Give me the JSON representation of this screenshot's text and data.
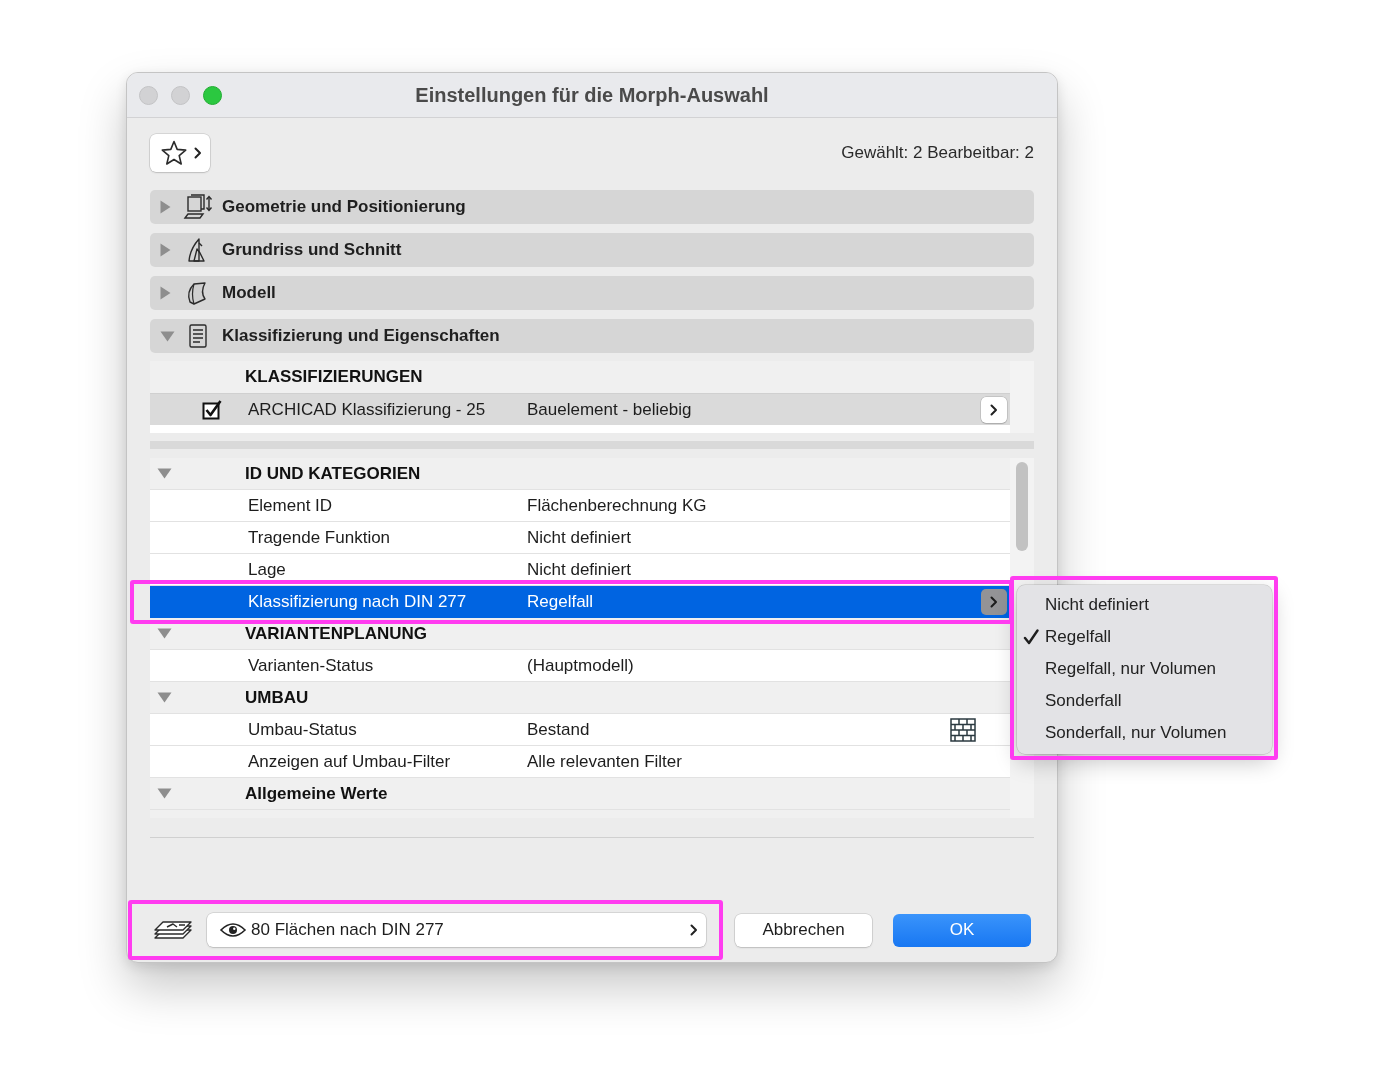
{
  "window": {
    "title": "Einstellungen für die Morph-Auswahl"
  },
  "toolbar": {
    "selection_info": "Gewählt: 2 Bearbeitbar: 2"
  },
  "sections": [
    {
      "kind": "geometry",
      "label": "Geometrie und Positionierung",
      "expanded": false
    },
    {
      "kind": "floorplan",
      "label": "Grundriss und Schnitt",
      "expanded": false
    },
    {
      "kind": "model",
      "label": "Modell",
      "expanded": false
    },
    {
      "kind": "classification",
      "label": "Klassifizierung und Eigenschaften",
      "expanded": true
    }
  ],
  "classifications": {
    "heading": "KLASSIFIZIERUNGEN",
    "rows": [
      {
        "checked": true,
        "system": "ARCHICAD Klassifizierung - 25",
        "value": "Bauelement - beliebig",
        "selected": true
      }
    ]
  },
  "properties": {
    "groups": [
      {
        "label": "ID UND KATEGORIEN",
        "expanded": true,
        "rows": [
          {
            "kind": "text",
            "name": "Element ID",
            "value": "Flächenberechnung KG",
            "selected": false,
            "highlighted": false
          },
          {
            "kind": "text",
            "name": "Tragende Funktion",
            "value": "Nicht definiert",
            "selected": false,
            "highlighted": false
          },
          {
            "kind": "text",
            "name": "Lage",
            "value": "Nicht definiert",
            "selected": false,
            "highlighted": false
          },
          {
            "kind": "choice",
            "name": "Klassifizierung nach DIN 277",
            "value": "Regelfall",
            "selected": true,
            "highlighted": true
          }
        ]
      },
      {
        "label": "VARIANTENPLANUNG",
        "expanded": true,
        "rows": [
          {
            "kind": "text",
            "name": "Varianten-Status",
            "value": "(Hauptmodell)",
            "selected": false,
            "highlighted": false
          }
        ]
      },
      {
        "label": "UMBAU",
        "expanded": true,
        "rows": [
          {
            "kind": "status",
            "name": "Umbau-Status",
            "value": "Bestand",
            "selected": false,
            "highlighted": false
          },
          {
            "kind": "text",
            "name": "Anzeigen auf Umbau-Filter",
            "value": "Alle relevanten Filter",
            "selected": false,
            "highlighted": false
          }
        ]
      },
      {
        "label": "Allgemeine Werte",
        "expanded": true
      }
    ]
  },
  "popup_menu": {
    "highlighted": true,
    "items": [
      {
        "label": "Nicht definiert",
        "selected": false
      },
      {
        "label": "Regelfall",
        "selected": true
      },
      {
        "label": "Regelfall, nur Volumen",
        "selected": false
      },
      {
        "label": "Sonderfall",
        "selected": false
      },
      {
        "label": "Sonderfall, nur Volumen",
        "selected": false
      }
    ]
  },
  "footer": {
    "layer_selector": {
      "label": "80 Flächen nach DIN 277",
      "highlighted": true
    },
    "buttons": [
      {
        "kind": "secondary",
        "label": "Abbrechen"
      },
      {
        "kind": "primary",
        "label": "OK"
      }
    ]
  }
}
